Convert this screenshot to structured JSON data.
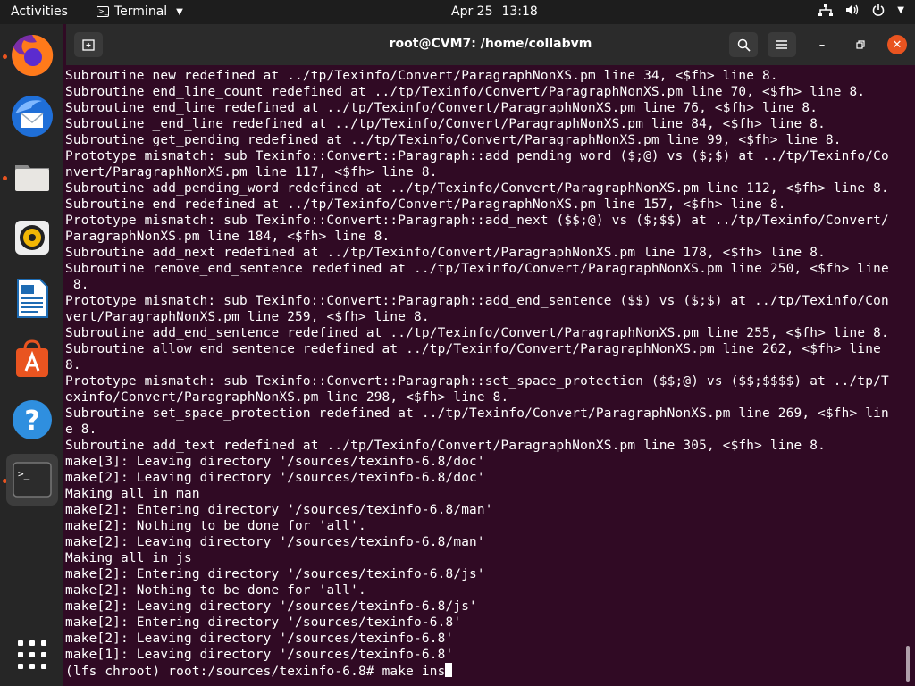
{
  "topbar": {
    "activities": "Activities",
    "app_name": "Terminal",
    "date": "Apr 25",
    "time": "13:18"
  },
  "dock": {
    "items": [
      {
        "name": "firefox",
        "running": true
      },
      {
        "name": "thunderbird",
        "running": false
      },
      {
        "name": "files",
        "running": true
      },
      {
        "name": "rhythmbox",
        "running": false
      },
      {
        "name": "libreoffice-writer",
        "running": false
      },
      {
        "name": "ubuntu-software",
        "running": false
      },
      {
        "name": "help",
        "running": false
      },
      {
        "name": "terminal",
        "running": true,
        "active": true
      }
    ],
    "show_apps_icon": "grid-icon"
  },
  "window": {
    "title": "root@CVM7: /home/collabvm"
  },
  "terminal": {
    "lines": [
      "Subroutine new redefined at ../tp/Texinfo/Convert/ParagraphNonXS.pm line 34, <$fh> line 8.",
      "Subroutine end_line_count redefined at ../tp/Texinfo/Convert/ParagraphNonXS.pm line 70, <$fh> line 8.",
      "Subroutine end_line redefined at ../tp/Texinfo/Convert/ParagraphNonXS.pm line 76, <$fh> line 8.",
      "Subroutine _end_line redefined at ../tp/Texinfo/Convert/ParagraphNonXS.pm line 84, <$fh> line 8.",
      "Subroutine get_pending redefined at ../tp/Texinfo/Convert/ParagraphNonXS.pm line 99, <$fh> line 8.",
      "Prototype mismatch: sub Texinfo::Convert::Paragraph::add_pending_word ($;@) vs ($;$) at ../tp/Texinfo/Co",
      "nvert/ParagraphNonXS.pm line 117, <$fh> line 8.",
      "Subroutine add_pending_word redefined at ../tp/Texinfo/Convert/ParagraphNonXS.pm line 112, <$fh> line 8.",
      "Subroutine end redefined at ../tp/Texinfo/Convert/ParagraphNonXS.pm line 157, <$fh> line 8.",
      "Prototype mismatch: sub Texinfo::Convert::Paragraph::add_next ($$;@) vs ($;$$) at ../tp/Texinfo/Convert/",
      "ParagraphNonXS.pm line 184, <$fh> line 8.",
      "Subroutine add_next redefined at ../tp/Texinfo/Convert/ParagraphNonXS.pm line 178, <$fh> line 8.",
      "Subroutine remove_end_sentence redefined at ../tp/Texinfo/Convert/ParagraphNonXS.pm line 250, <$fh> line",
      " 8.",
      "Prototype mismatch: sub Texinfo::Convert::Paragraph::add_end_sentence ($$) vs ($;$) at ../tp/Texinfo/Con",
      "vert/ParagraphNonXS.pm line 259, <$fh> line 8.",
      "Subroutine add_end_sentence redefined at ../tp/Texinfo/Convert/ParagraphNonXS.pm line 255, <$fh> line 8.",
      "Subroutine allow_end_sentence redefined at ../tp/Texinfo/Convert/ParagraphNonXS.pm line 262, <$fh> line",
      "8.",
      "Prototype mismatch: sub Texinfo::Convert::Paragraph::set_space_protection ($$;@) vs ($$;$$$$) at ../tp/T",
      "exinfo/Convert/ParagraphNonXS.pm line 298, <$fh> line 8.",
      "Subroutine set_space_protection redefined at ../tp/Texinfo/Convert/ParagraphNonXS.pm line 269, <$fh> lin",
      "e 8.",
      "Subroutine add_text redefined at ../tp/Texinfo/Convert/ParagraphNonXS.pm line 305, <$fh> line 8.",
      "make[3]: Leaving directory '/sources/texinfo-6.8/doc'",
      "make[2]: Leaving directory '/sources/texinfo-6.8/doc'",
      "Making all in man",
      "make[2]: Entering directory '/sources/texinfo-6.8/man'",
      "make[2]: Nothing to be done for 'all'.",
      "make[2]: Leaving directory '/sources/texinfo-6.8/man'",
      "Making all in js",
      "make[2]: Entering directory '/sources/texinfo-6.8/js'",
      "make[2]: Nothing to be done for 'all'.",
      "make[2]: Leaving directory '/sources/texinfo-6.8/js'",
      "make[2]: Entering directory '/sources/texinfo-6.8'",
      "make[2]: Leaving directory '/sources/texinfo-6.8'",
      "make[1]: Leaving directory '/sources/texinfo-6.8'"
    ],
    "prompt": "(lfs chroot) root:/sources/texinfo-6.8# ",
    "input": "make ins"
  }
}
